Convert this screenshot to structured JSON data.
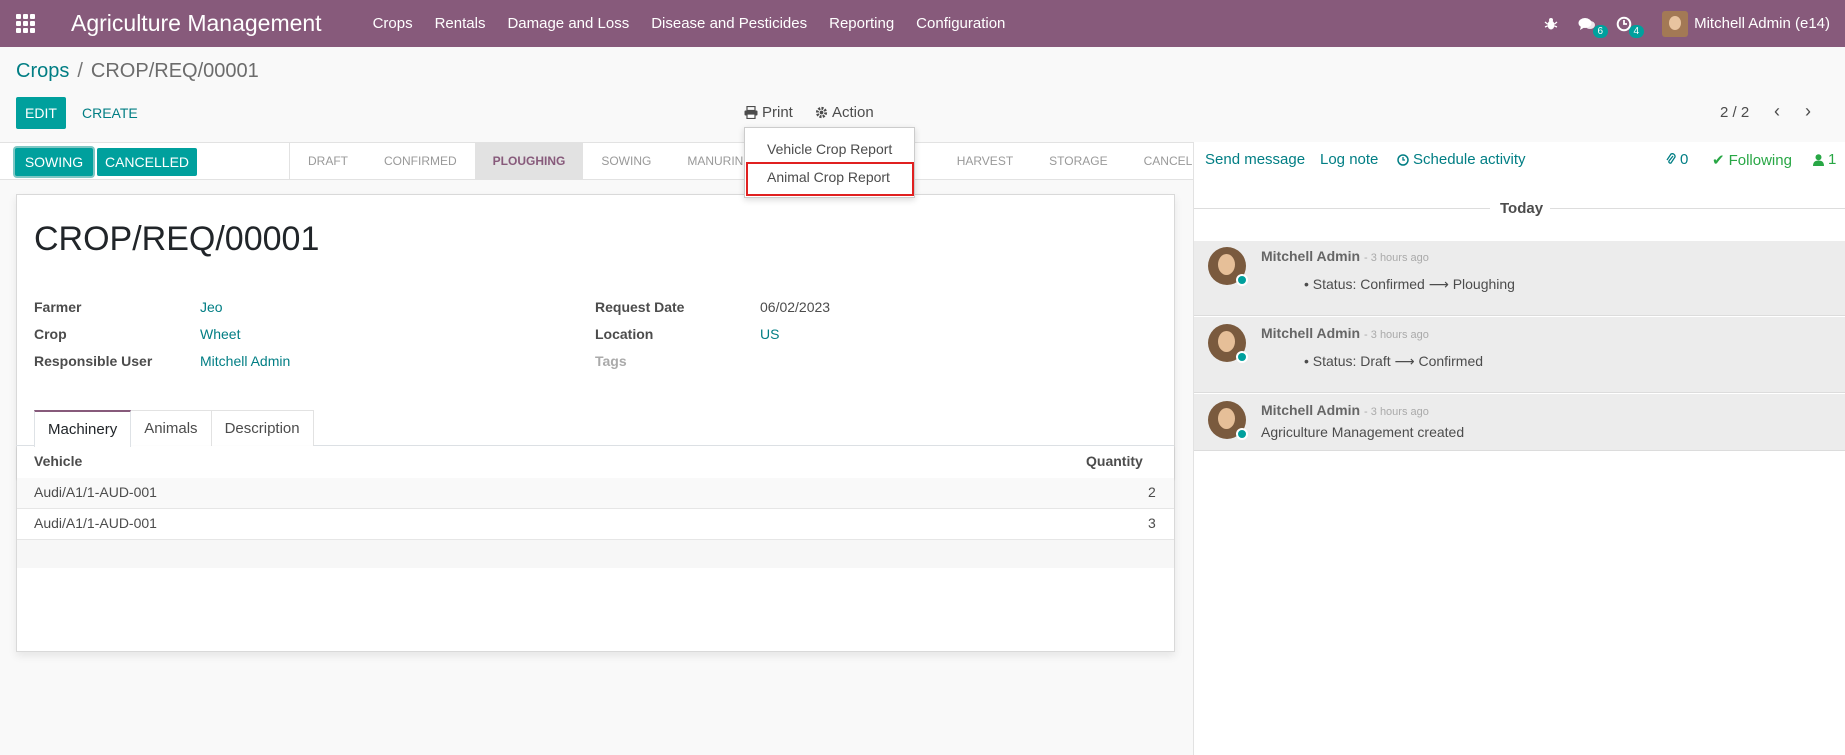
{
  "navbar": {
    "app_title": "Agriculture Management",
    "menu": [
      "Crops",
      "Rentals",
      "Damage and Loss",
      "Disease and Pesticides",
      "Reporting",
      "Configuration"
    ],
    "messages_count": "6",
    "activities_count": "4",
    "user_name": "Mitchell Admin (e14)"
  },
  "breadcrumb": {
    "parent": "Crops",
    "separator": "/",
    "current": "CROP/REQ/00001"
  },
  "buttons": {
    "edit": "EDIT",
    "create": "CREATE",
    "print": "Print",
    "action": "Action"
  },
  "pager": {
    "value": "2 / 2"
  },
  "print_menu": {
    "items": [
      "Vehicle Crop Report",
      "Animal Crop Report"
    ]
  },
  "statusbar": {
    "buttons": [
      "SOWING",
      "CANCELLED"
    ],
    "stages": [
      "DRAFT",
      "CONFIRMED",
      "PLOUGHING",
      "SOWING",
      "MANURING",
      "HARVEST",
      "STORAGE",
      "CANCEL"
    ],
    "current_stage": "PLOUGHING"
  },
  "record": {
    "title": "CROP/REQ/00001",
    "fields": {
      "farmer_label": "Farmer",
      "farmer": "Jeo",
      "crop_label": "Crop",
      "crop": "Wheet",
      "responsible_label": "Responsible User",
      "responsible": "Mitchell Admin",
      "request_date_label": "Request Date",
      "request_date": "06/02/2023",
      "location_label": "Location",
      "location": "US",
      "tags_label": "Tags"
    }
  },
  "tabs": [
    "Machinery",
    "Animals",
    "Description"
  ],
  "machinery_table": {
    "columns": [
      "Vehicle",
      "Quantity"
    ],
    "rows": [
      {
        "vehicle": "Audi/A1/1-AUD-001",
        "quantity": "2"
      },
      {
        "vehicle": "Audi/A1/1-AUD-001",
        "quantity": "3"
      }
    ]
  },
  "chatter": {
    "send_message": "Send message",
    "log_note": "Log note",
    "schedule_activity": "Schedule activity",
    "attachments_count": "0",
    "following": "Following",
    "followers_count": "1",
    "date_separator": "Today",
    "messages": [
      {
        "author": "Mitchell Admin",
        "time": "- 3 hours ago",
        "body": "Status: Confirmed ⟶ Ploughing"
      },
      {
        "author": "Mitchell Admin",
        "time": "- 3 hours ago",
        "body": "Status: Draft ⟶ Confirmed"
      },
      {
        "author": "Mitchell Admin",
        "time": "- 3 hours ago",
        "body": "Agriculture Management created"
      }
    ]
  },
  "colors": {
    "brand": "#875a7b",
    "accent": "#00a09d",
    "link": "#017e84",
    "highlight": "#e02020"
  }
}
